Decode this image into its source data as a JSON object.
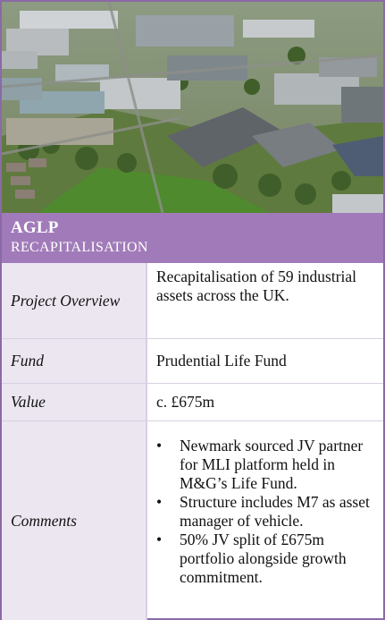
{
  "header": {
    "title": "AGLP",
    "subtitle": "RECAPITALISATION"
  },
  "photo": {
    "icon": "aerial-industrial-estate"
  },
  "table": {
    "rows": [
      {
        "label": "Project Overview",
        "value": "Recapitalisation of 59 industrial assets across the UK."
      },
      {
        "label": "Fund",
        "value": "Prudential Life Fund"
      },
      {
        "label": "Value",
        "value": "c. £675m"
      },
      {
        "label": "Comments",
        "bullets": [
          "Newmark sourced JV partner for MLI platform held in M&G’s Life Fund.",
          "Structure includes M7 as asset manager of vehicle.",
          "50% JV split of £675m portfolio alongside growth commitment."
        ]
      }
    ]
  },
  "colors": {
    "band": "#a17bb9",
    "label_bg": "#ece6f1",
    "border": "#8b6aa6"
  }
}
